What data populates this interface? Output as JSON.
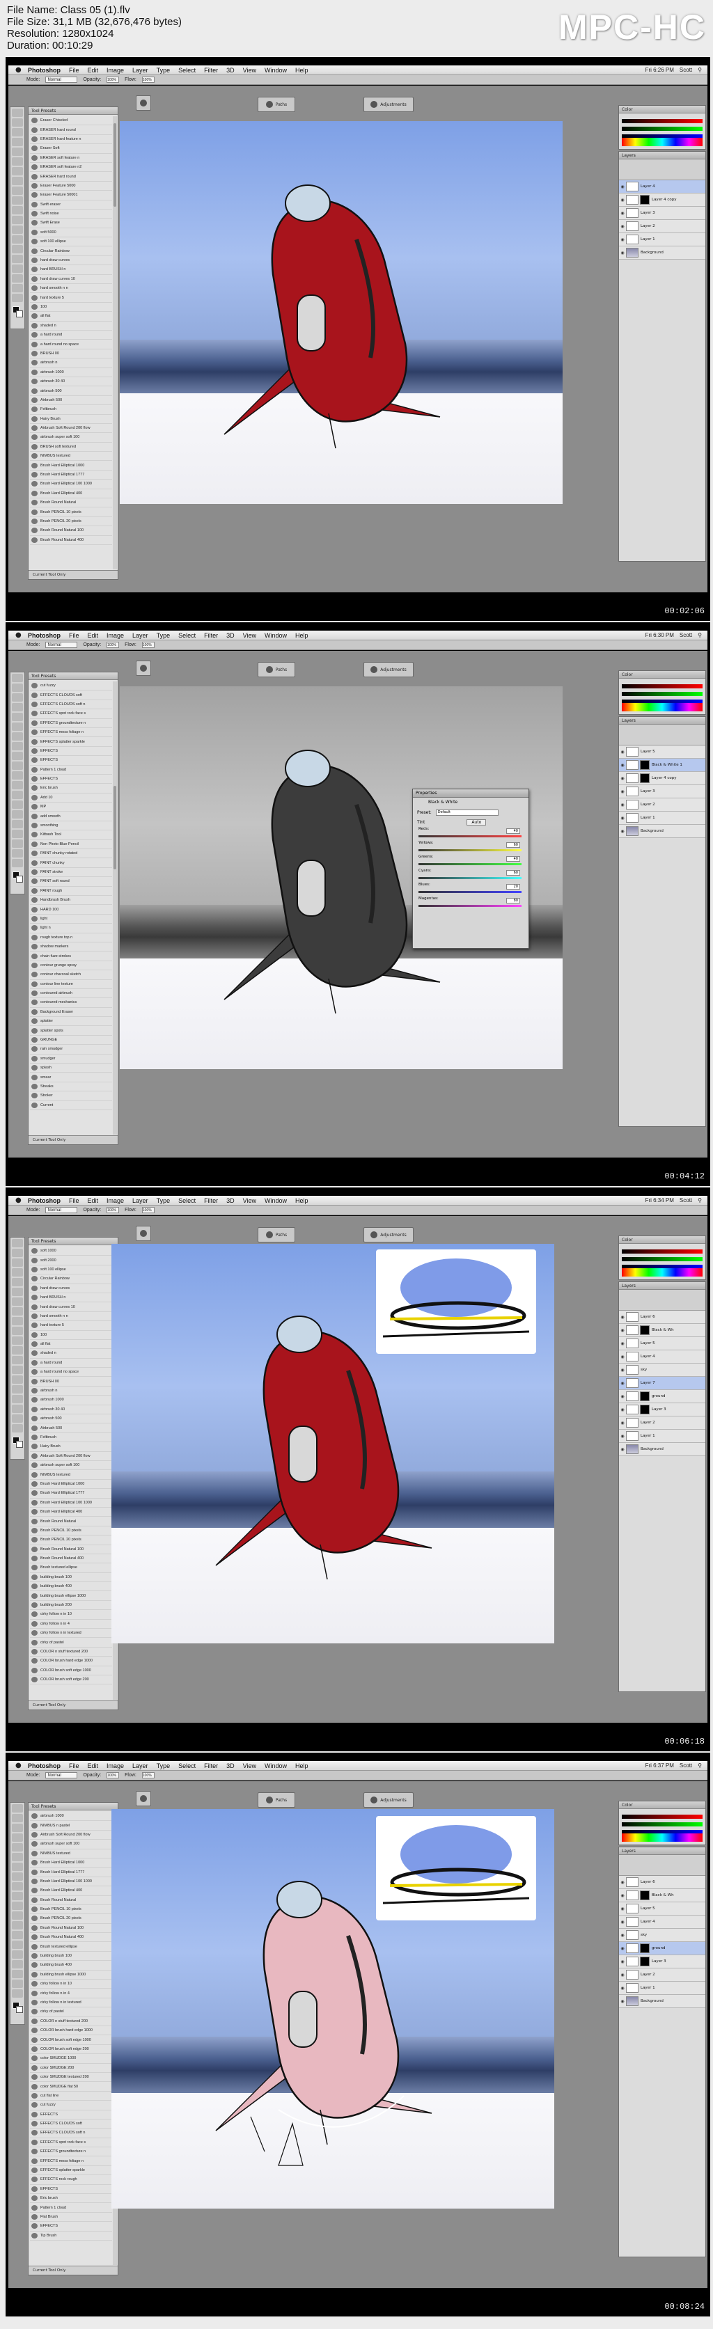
{
  "header": {
    "file_name": "File Name: Class 05 (1).flv",
    "file_size": "File Size: 31,1 MB (32,676,476 bytes)",
    "resolution": "Resolution: 1280x1024",
    "duration": "Duration: 00:10:29",
    "logo": "MPC-HC"
  },
  "app": {
    "apple_icon": "apple-icon",
    "menu": [
      "Photoshop",
      "File",
      "Edit",
      "Image",
      "Layer",
      "Type",
      "Select",
      "Filter",
      "3D",
      "View",
      "Window",
      "Help"
    ],
    "options": {
      "mode_label": "Mode:",
      "mode_value": "Normal",
      "opacity_label": "Opacity:",
      "opacity_value": "100%",
      "flow_label": "Flow:",
      "flow_value": "100%"
    },
    "user": "Scott",
    "preset_panel_title": "Tool Presets",
    "preset_footer": "Current Tool Only",
    "paths_button": "Paths",
    "adjustments_button": "Adjustments",
    "layers_title": "Layers",
    "color_title": "Color"
  },
  "frames": [
    {
      "timecode": "00:02:06",
      "clock": "Fri 6:26 PM",
      "presets": [
        "Eraser Chiseled",
        "ERASER hard round",
        "ERASER hard feature n",
        "Eraser Soft",
        "ERASER soft feature n",
        "ERASER soft feature n2",
        "ERASER hard round",
        "Eraser Feature 5000",
        "Eraser Feature 50001",
        "Swift eraser",
        "Swift noise",
        "Swift Erase",
        "soft 5000",
        "soft 100 ellipse",
        "Circular Rainbow",
        "hard draw curves",
        "hard BRUSH n",
        "hard draw curves 10",
        "hard smooth n n",
        "hard texture 5",
        "100",
        "all flat",
        "shaded n",
        "a hard round",
        "a hard round no space",
        "BRUSH 00",
        "airbrush n",
        "airbrush 1000",
        "airbrush 30 40",
        "airbrush 500",
        "Airbrush 500",
        "Feltbrush",
        "Hairy Brush",
        "Airbrush Soft Round 200 flow",
        "airbrush super soft 100",
        "BRUSH soft textured",
        "NIMBUS textured",
        "Brush Hard Elliptical 1000",
        "Brush Hard Elliptical 1777",
        "Brush Hard Elliptical 100 1000",
        "Brush Hard Elliptical 400",
        "Brush Round Natural",
        "Brush PENCIL 10 pixels",
        "Brush PENCIL 20 pixels",
        "Brush Round Natural 100",
        "Brush Round Natural 400"
      ],
      "layers": [
        {
          "name": "Layer 4",
          "selected": true,
          "mask": false
        },
        {
          "name": "Layer 4 copy",
          "selected": false,
          "mask": true
        },
        {
          "name": "Layer 3",
          "selected": false,
          "mask": false
        },
        {
          "name": "Layer 2",
          "selected": false,
          "mask": false
        },
        {
          "name": "Layer 1",
          "selected": false,
          "mask": false
        },
        {
          "name": "Background",
          "selected": false,
          "mask": false,
          "bg": true
        }
      ]
    },
    {
      "timecode": "00:04:12",
      "clock": "Fri 6:30 PM",
      "presets": [
        "cut fuzzy",
        "EFFECTS CLOUDS soft",
        "EFFECTS CLOUDS soft n",
        "EFFECTS spot rock face s",
        "EFFECTS groundtexture n",
        "EFFECTS moss foliage n",
        "EFFECTS splatter sparkle",
        "EFFECTS",
        "EFFECTS",
        "Pattern 1 cloud",
        "EFFECTS",
        "Eric brush",
        "Add 10",
        "MP",
        "add smooth",
        "smoothing",
        "Kitbash Tool",
        "Non Photo Blue Pencil",
        "PAINT chunky rotated",
        "PAINT chunky",
        "PAINT stroke",
        "PAINT soft round",
        "PAINT rough",
        "Handbrush Brush",
        "HARD 100",
        "light",
        "light n",
        "rough texture top n",
        "shadow markers",
        "chain fuzz strokes",
        "contour grunge spray",
        "contour charcoal sketch",
        "contour line texture",
        "contoured airbrush",
        "contoured mechanics",
        "Background Eraser",
        "splatter",
        "splatter spots",
        "GRUNGE",
        "rain smudger",
        "smudger",
        "splash",
        "smear",
        "Streaks",
        "Stroker",
        "Current"
      ],
      "layers": [
        {
          "name": "Layer 5",
          "selected": false,
          "mask": false
        },
        {
          "name": "Black & White 1",
          "selected": true,
          "mask": true
        },
        {
          "name": "Layer 4 copy",
          "selected": false,
          "mask": true
        },
        {
          "name": "Layer 3",
          "selected": false,
          "mask": false
        },
        {
          "name": "Layer 2",
          "selected": false,
          "mask": false
        },
        {
          "name": "Layer 1",
          "selected": false,
          "mask": false
        },
        {
          "name": "Background",
          "selected": false,
          "mask": false,
          "bg": true
        }
      ],
      "bw_dialog": {
        "title": "Properties",
        "subtitle": "Black & White",
        "preset_label": "Preset:",
        "preset_value": "Default",
        "tint": "Tint",
        "auto": "Auto",
        "channels": [
          {
            "label": "Reds:",
            "value": "40"
          },
          {
            "label": "Yellows:",
            "value": "60"
          },
          {
            "label": "Greens:",
            "value": "40"
          },
          {
            "label": "Cyans:",
            "value": "60"
          },
          {
            "label": "Blues:",
            "value": "20"
          },
          {
            "label": "Magentas:",
            "value": "80"
          }
        ]
      }
    },
    {
      "timecode": "00:06:18",
      "clock": "Fri 6:34 PM",
      "presets": [
        "soft 1000",
        "soft 2000",
        "soft 100 ellipse",
        "Circular Rainbow",
        "hard draw curves",
        "hard BRUSH n",
        "hard draw curves 10",
        "hard smooth n n",
        "hard texture 5",
        "100",
        "all flat",
        "shaded n",
        "a hard round",
        "a hard round no space",
        "BRUSH 00",
        "airbrush n",
        "airbrush 1000",
        "airbrush 30 40",
        "airbrush 500",
        "Airbrush 500",
        "Feltbrush",
        "Hairy Brush",
        "Airbrush Soft Round 200 flow",
        "airbrush super soft 100",
        "NIMBUS textured",
        "Brush Hard Elliptical 1000",
        "Brush Hard Elliptical 1777",
        "Brush Hard Elliptical 100 1000",
        "Brush Hard Elliptical 400",
        "Brush Round Natural",
        "Brush PENCIL 10 pixels",
        "Brush PENCIL 20 pixels",
        "Brush Round Natural 100",
        "Brush Round Natural 400",
        "Brush textured ellipse",
        "building brush 100",
        "building brush 400",
        "building brush ellipse 1000",
        "building brush 200",
        "cirky follow n in 10",
        "cirky follow n in 4",
        "cirky follow n in textured",
        "cirky of pastel",
        "COLOR n stuff textured 200",
        "COLOR brush hard edge 1000",
        "COLOR brush soft edge 1000",
        "COLOR brush soft edge 200"
      ],
      "layers": [
        {
          "name": "Layer 6",
          "selected": false,
          "mask": false
        },
        {
          "name": "Black & Wh",
          "selected": false,
          "mask": true
        },
        {
          "name": "Layer 5",
          "selected": false,
          "mask": false
        },
        {
          "name": "Layer 4",
          "selected": false,
          "mask": false
        },
        {
          "name": "sky",
          "selected": false,
          "mask": false
        },
        {
          "name": "Layer 7",
          "selected": true,
          "mask": false
        },
        {
          "name": "ground",
          "selected": false,
          "mask": true
        },
        {
          "name": "Layer 3",
          "selected": false,
          "mask": true
        },
        {
          "name": "Layer 2",
          "selected": false,
          "mask": false
        },
        {
          "name": "Layer 1",
          "selected": false,
          "mask": false
        },
        {
          "name": "Background",
          "selected": false,
          "mask": false,
          "bg": true
        }
      ]
    },
    {
      "timecode": "00:08:24",
      "clock": "Fri 6:37 PM",
      "presets": [
        "airbrush 1000",
        "NIMBUS n pastel",
        "Airbrush Soft Round 200 flow",
        "airbrush super soft 100",
        "NIMBUS textured",
        "Brush Hard Elliptical 1000",
        "Brush Hard Elliptical 1777",
        "Brush Hard Elliptical 100 1000",
        "Brush Hard Elliptical 400",
        "Brush Round Natural",
        "Brush PENCIL 10 pixels",
        "Brush PENCIL 20 pixels",
        "Brush Round Natural 100",
        "Brush Round Natural 400",
        "Brush textured ellipse",
        "building brush 100",
        "building brush 400",
        "building brush ellipse 1000",
        "cirky follow n in 10",
        "cirky follow n in 4",
        "cirky follow n in textured",
        "cirky of pastel",
        "COLOR n stuff textured 200",
        "COLOR brush hard edge 1000",
        "COLOR brush soft edge 1000",
        "COLOR brush soft edge 200",
        "color SMUDGE 1000",
        "color SMUDGE 200",
        "color SMUDGE textured 200",
        "color SMUDGE flat 50",
        "cut flat line",
        "cut fuzzy",
        "EFFECTS",
        "EFFECTS CLOUDS soft",
        "EFFECTS CLOUDS soft n",
        "EFFECTS spot rock face s",
        "EFFECTS groundtexture n",
        "EFFECTS moss foliage n",
        "EFFECTS splatter sparkle",
        "EFFECTS rock rough",
        "EFFECTS",
        "Eric brush",
        "Pattern 1 cloud",
        "Flat Brush",
        "EFFECTS",
        "Tip Brush"
      ],
      "layers": [
        {
          "name": "Layer 6",
          "selected": false,
          "mask": false
        },
        {
          "name": "Black & Wh",
          "selected": false,
          "mask": true
        },
        {
          "name": "Layer 5",
          "selected": false,
          "mask": false
        },
        {
          "name": "Layer 4",
          "selected": false,
          "mask": false
        },
        {
          "name": "sky",
          "selected": false,
          "mask": false
        },
        {
          "name": "ground",
          "selected": true,
          "mask": true
        },
        {
          "name": "Layer 3",
          "selected": false,
          "mask": true
        },
        {
          "name": "Layer 2",
          "selected": false,
          "mask": false
        },
        {
          "name": "Layer 1",
          "selected": false,
          "mask": false
        },
        {
          "name": "Background",
          "selected": false,
          "mask": false,
          "bg": true
        }
      ]
    }
  ]
}
